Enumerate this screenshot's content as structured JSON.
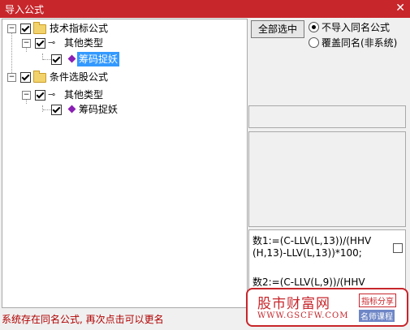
{
  "window": {
    "title": "导入公式",
    "close_glyph": "✕"
  },
  "tree": {
    "expand_glyph": "−",
    "nodes": [
      {
        "label": "技术指标公式"
      },
      {
        "label": "其他类型"
      },
      {
        "label": "筹码捉妖"
      },
      {
        "label": "条件选股公式"
      },
      {
        "label": "其他类型"
      },
      {
        "label": "筹码捉妖"
      }
    ]
  },
  "buttons": {
    "select_all": "全部选中"
  },
  "options": {
    "no_import_same_name": "不导入同名公式",
    "overwrite_same_name": "覆盖同名(非系统)",
    "selected": "no_import_same_name"
  },
  "formula": {
    "lines": [
      "数1:=(C-LLV(L,13))/(HHV",
      "(H,13)-LLV(L,13))*100;",
      "",
      "数2:=(C-LLV(L,9))/(HHV"
    ]
  },
  "status": "系统存在同名公式, 再次点击可以更名",
  "watermark": {
    "name": "股市财富网",
    "url": "WWW.GSCFW.COM",
    "tag1": "指标分享",
    "tag2": "名师课程"
  },
  "colors": {
    "title_bar": "#c7262b",
    "selection": "#3399ff",
    "status_text": "#b00000"
  }
}
